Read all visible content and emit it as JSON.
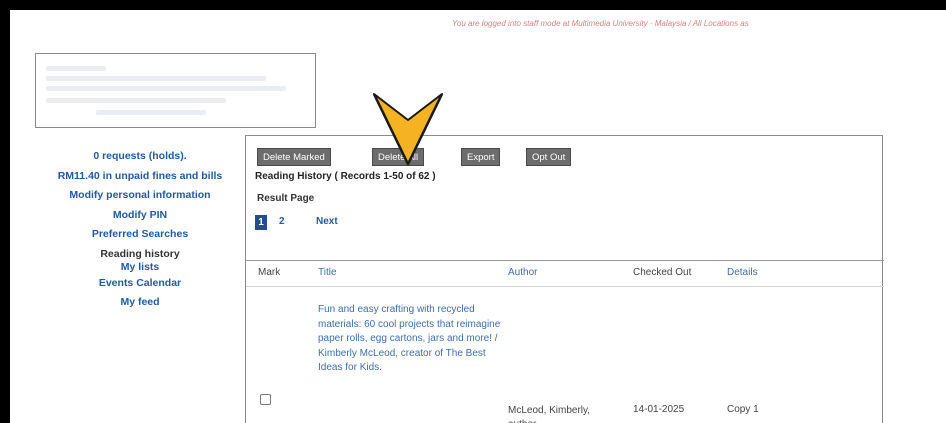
{
  "banner": {
    "text": "You are logged into staff mode at Multimedia University - Malaysia / All Locations as"
  },
  "sidebar": {
    "requests": "0 requests (holds).",
    "fines": "RM11.40 in unpaid fines and bills",
    "modify_info": "Modify personal information",
    "modify_pin": "Modify PIN",
    "preferred": "Preferred Searches",
    "reading_history": "Reading history",
    "my_lists": "My lists",
    "events": "Events Calendar",
    "feed": "My feed"
  },
  "toolbar": {
    "delete_marked": "Delete Marked",
    "delete_all": "Delete All",
    "export": "Export",
    "opt_out": "Opt Out"
  },
  "history": {
    "title": "Reading History ( Records 1-50 of 62 )",
    "result_page_label": "Result Page",
    "pages": [
      "1",
      "2"
    ],
    "next": "Next"
  },
  "table": {
    "headers": {
      "mark": "Mark",
      "title": "Title",
      "author": "Author",
      "checked_out": "Checked Out",
      "details": "Details"
    },
    "rows": [
      {
        "title": "Fun and easy crafting with recycled materials: 60 cool projects that reimagine paper rolls, egg cartons, jars and more! / Kimberly McLeod, creator of The Best Ideas for Kids.",
        "author": "McLeod, Kimberly, author.",
        "checked_out": "14-01-2025",
        "details": "Copy 1",
        "marked": false
      }
    ]
  },
  "colors": {
    "pointer": "#f5b324",
    "link": "#1f5aa6",
    "button": "#6c6c6c",
    "current_page": "#1f4f93"
  },
  "icons": {
    "pointer": "down-chevron-arrow-icon"
  }
}
